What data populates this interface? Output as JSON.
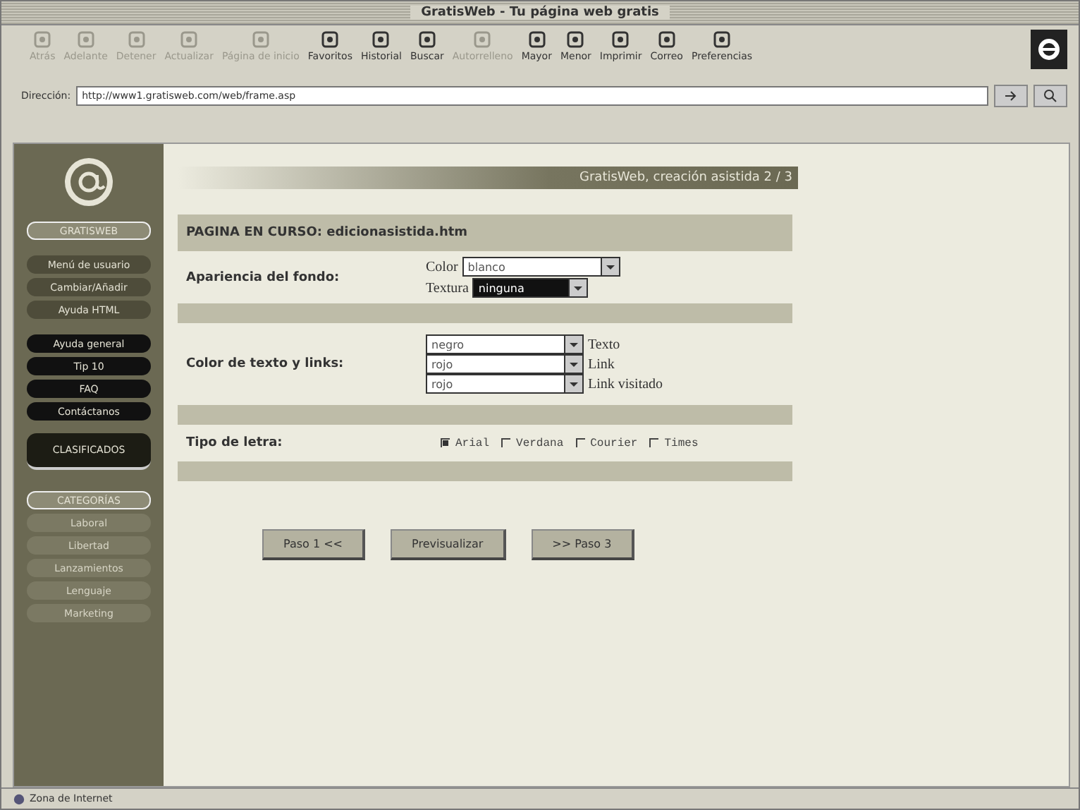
{
  "window": {
    "title": "GratisWeb - Tu página web gratis"
  },
  "toolbar": [
    {
      "label": "Atrás",
      "disabled": true
    },
    {
      "label": "Adelante",
      "disabled": true
    },
    {
      "label": "Detener",
      "disabled": true
    },
    {
      "label": "Actualizar",
      "disabled": true
    },
    {
      "label": "Página de inicio",
      "disabled": true
    },
    {
      "label": "Favoritos",
      "disabled": false
    },
    {
      "label": "Historial",
      "disabled": false
    },
    {
      "label": "Buscar",
      "disabled": false
    },
    {
      "label": "Autorrelleno",
      "disabled": true
    },
    {
      "label": "Mayor",
      "disabled": false
    },
    {
      "label": "Menor",
      "disabled": false
    },
    {
      "label": "Imprimir",
      "disabled": false
    },
    {
      "label": "Correo",
      "disabled": false
    },
    {
      "label": "Preferencias",
      "disabled": false
    }
  ],
  "address": {
    "label": "Dirección:",
    "value": "http://www1.gratisweb.com/web/frame.asp"
  },
  "sidebar": {
    "logo": "GRATISWEB",
    "items": [
      {
        "kind": "pill",
        "label": "Menú de usuario"
      },
      {
        "kind": "pill",
        "label": "Cambiar/Añadir"
      },
      {
        "kind": "pill",
        "label": "Ayuda HTML"
      },
      {
        "kind": "dark",
        "label": "Ayuda general"
      },
      {
        "kind": "dark",
        "label": "Tip 10"
      },
      {
        "kind": "dark",
        "label": "FAQ"
      },
      {
        "kind": "dark",
        "label": "Contáctanos"
      },
      {
        "kind": "banner",
        "label": "CLASIFICADOS"
      },
      {
        "kind": "heading",
        "label": "CATEGORÍAS"
      },
      {
        "kind": "category",
        "label": "Laboral"
      },
      {
        "kind": "category",
        "label": "Libertad"
      },
      {
        "kind": "category",
        "label": "Lanzamientos"
      },
      {
        "kind": "category",
        "label": "Lenguaje"
      },
      {
        "kind": "category",
        "label": "Marketing"
      }
    ]
  },
  "banner": "GratisWeb, creación asistida 2 / 3",
  "current_page": "PAGINA EN CURSO: edicionasistida.htm",
  "background": {
    "label": "Apariencia del fondo:",
    "fields": [
      {
        "label": "Color",
        "value": "blanco",
        "highlighted": false
      },
      {
        "label": "Textura",
        "value": "ninguna",
        "highlighted": true
      }
    ]
  },
  "text_colors": {
    "label": "Color de texto y links:",
    "fields": [
      {
        "value": "negro",
        "label": "Texto"
      },
      {
        "value": "rojo",
        "label": "Link"
      },
      {
        "value": "rojo",
        "label": "Link visitado"
      }
    ]
  },
  "font": {
    "label": "Tipo de letra:",
    "options": [
      {
        "label": "Arial",
        "selected": true
      },
      {
        "label": "Verdana",
        "selected": false
      },
      {
        "label": "Courier",
        "selected": false
      },
      {
        "label": "Times",
        "selected": false
      }
    ]
  },
  "buttons": [
    "Paso 1 <<",
    "Previsualizar",
    ">> Paso 3"
  ],
  "status_bar": "Zona de Internet"
}
